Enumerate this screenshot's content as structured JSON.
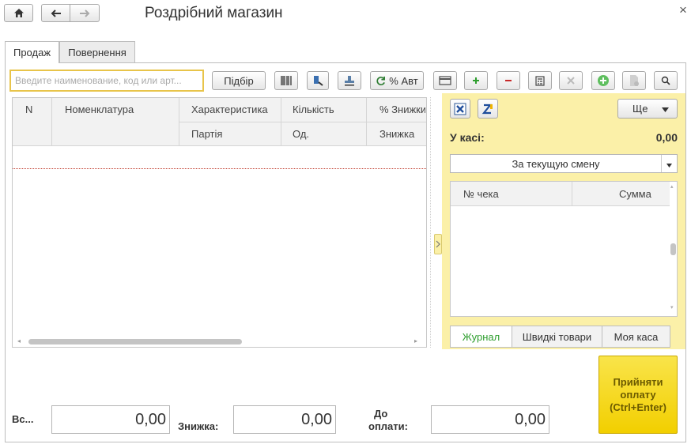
{
  "window": {
    "title": "Роздрібний магазин",
    "close_glyph": "×"
  },
  "tabs": [
    {
      "label": "Продаж",
      "active": true
    },
    {
      "label": "Повернення",
      "active": false
    }
  ],
  "toolbar": {
    "search_placeholder": "Введите наименование, код или арт...",
    "pick_label": "Підбір",
    "auto_discount_label": "% Авт"
  },
  "table": {
    "columns_top": [
      "N",
      "Номенклатура",
      "Характеристика",
      "Кількість",
      "% Знижки"
    ],
    "columns_bottom": [
      "Партія",
      "Од.",
      "Знижка"
    ]
  },
  "register": {
    "more_label": "Ще",
    "in_register_label": "У касі:",
    "in_register_value": "0,00",
    "shift_select": "За текущую смену",
    "receipt_columns": [
      "№ чека",
      "Сумма"
    ],
    "bottom_tabs": [
      "Журнал",
      "Швидкі товари",
      "Моя каса"
    ],
    "active_bottom_tab": "Журнал"
  },
  "totals": {
    "total_label": "Вс...",
    "total_value": "0,00",
    "discount_label": "Знижка:",
    "discount_value": "0,00",
    "due_label_line1": "До",
    "due_label_line2": "оплати:",
    "due_value": "0,00"
  },
  "accept_payment": {
    "line1": "Прийняти",
    "line2": "оплату",
    "line3": "(Ctrl+Enter)"
  },
  "colors": {
    "yellow_panel": "#fbf0a8",
    "accept_yellow": "#f7d800",
    "active_tab_green": "#2e9e2e",
    "search_border": "#e8c44a"
  }
}
